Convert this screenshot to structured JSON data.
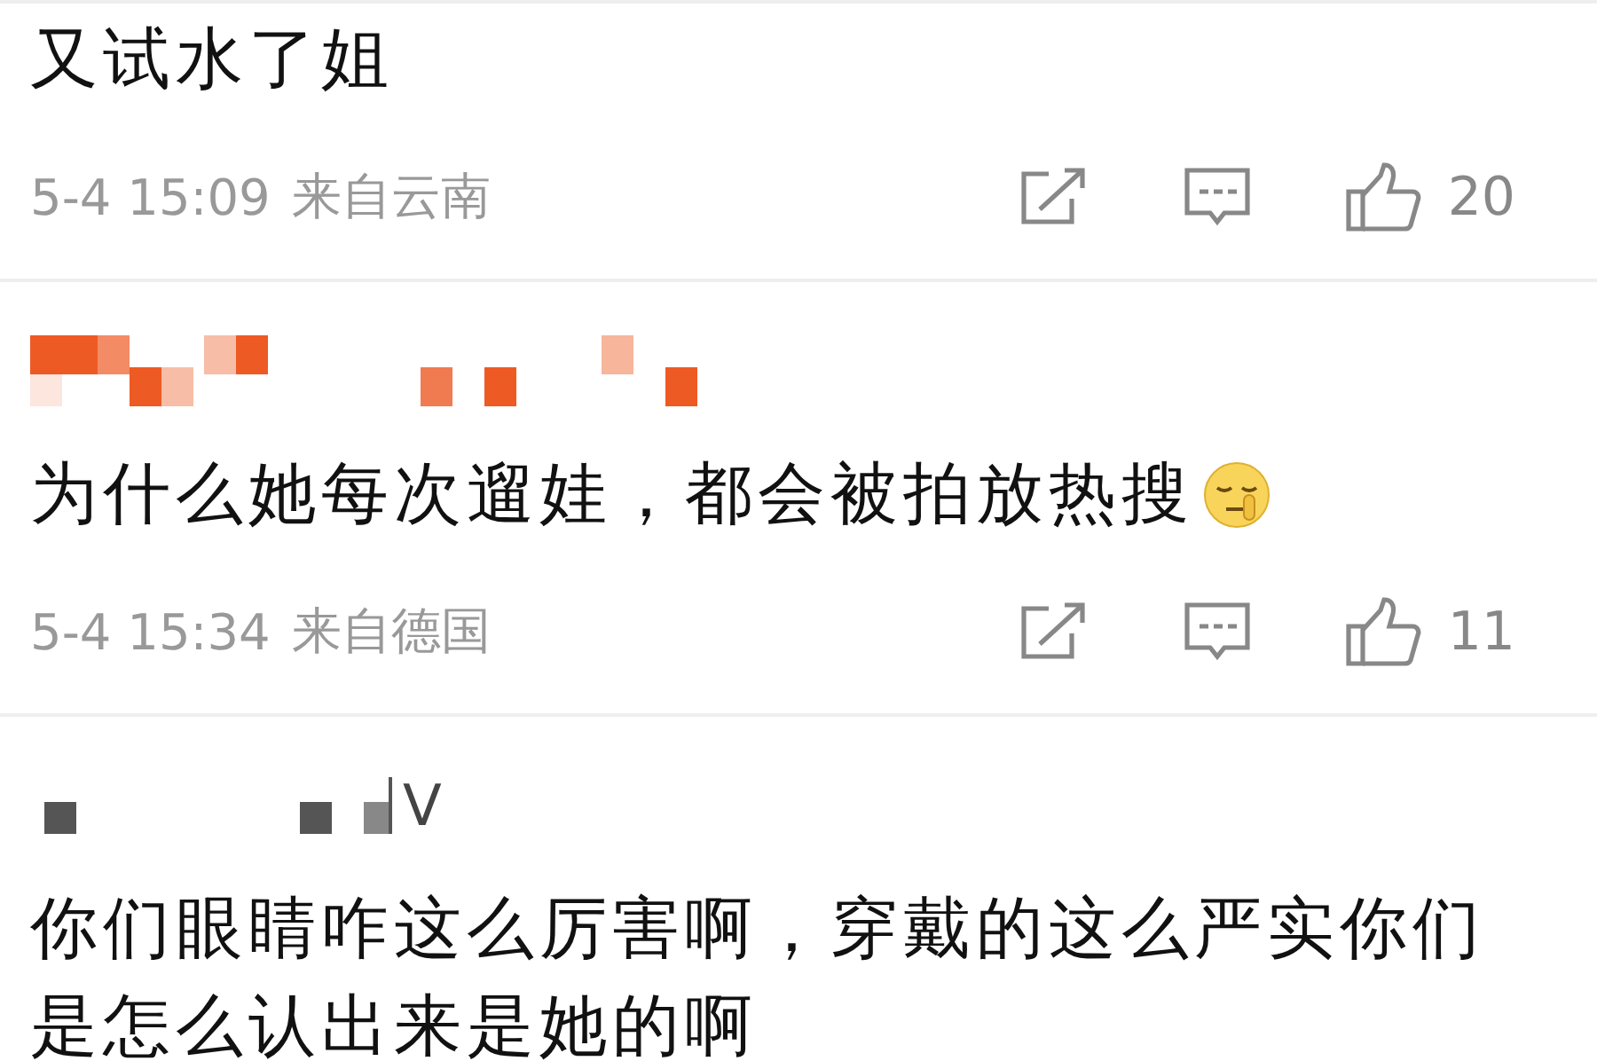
{
  "comments": [
    {
      "text": "又试水了姐",
      "time": "5-4 15:09",
      "location": "来自云南",
      "likes": "20"
    },
    {
      "name_mosaic": {
        "color": "#ee5a24"
      },
      "text": "为什么她每次遛娃，都会被拍放热搜",
      "emoji": {
        "kind": "shush"
      },
      "time": "5-4 15:34",
      "location": "来自德国",
      "likes": "11"
    },
    {
      "name_mosaic": {
        "color": "#555555",
        "badge": "V"
      },
      "text": "你们眼睛咋这么厉害啊，穿戴的这么严实你们是怎么认出来是她的啊"
    }
  ]
}
